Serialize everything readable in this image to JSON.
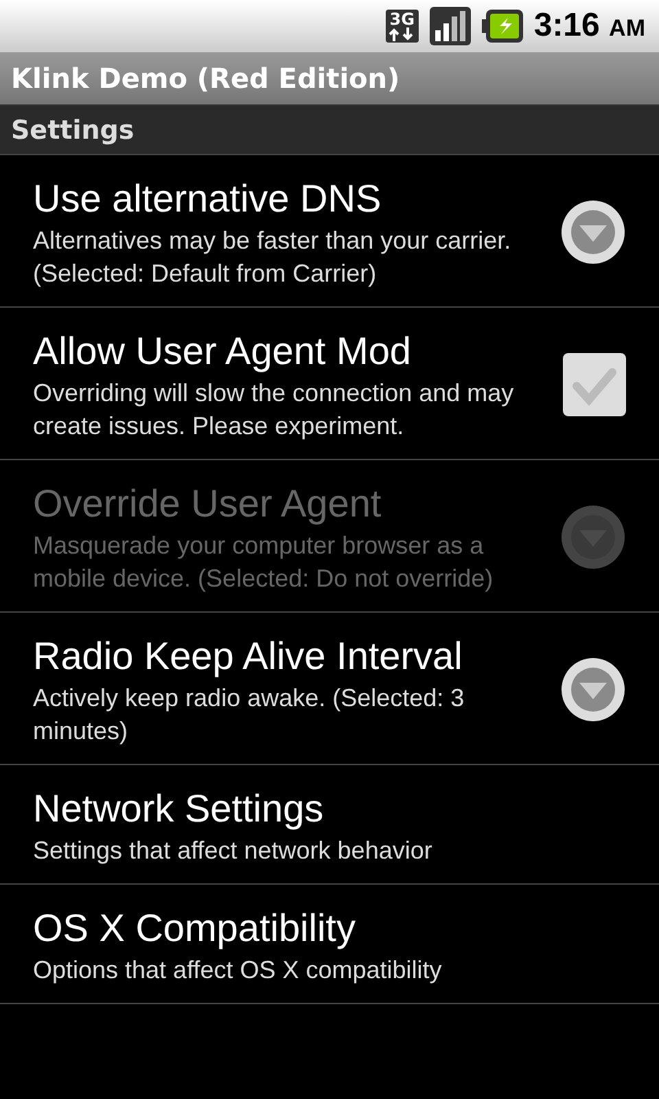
{
  "status_bar": {
    "network": "3G",
    "time": "3:16",
    "ampm": "AM"
  },
  "window": {
    "title": "Klink Demo (Red Edition)"
  },
  "section": "Settings",
  "items": [
    {
      "kind": "list",
      "title": "Use alternative DNS",
      "summary": "Alternatives may be faster than your carrier. (Selected: Default from Carrier)",
      "disabled": false
    },
    {
      "kind": "checkbox",
      "title": "Allow User Agent Mod",
      "summary": "Overriding will slow the connection and may create issues. Please experiment.",
      "disabled": false,
      "checked": false
    },
    {
      "kind": "list",
      "title": "Override User Agent",
      "summary": "Masquerade your computer browser as a mobile device. (Selected: Do not override)",
      "disabled": true
    },
    {
      "kind": "list",
      "title": "Radio Keep Alive Interval",
      "summary": "Actively keep radio awake. (Selected: 3 minutes)",
      "disabled": false
    },
    {
      "kind": "screen",
      "title": "Network Settings",
      "summary": "Settings that affect network behavior",
      "disabled": false
    },
    {
      "kind": "screen",
      "title": "OS X Compatibility",
      "summary": "Options that affect OS X compatibility",
      "disabled": false
    }
  ]
}
